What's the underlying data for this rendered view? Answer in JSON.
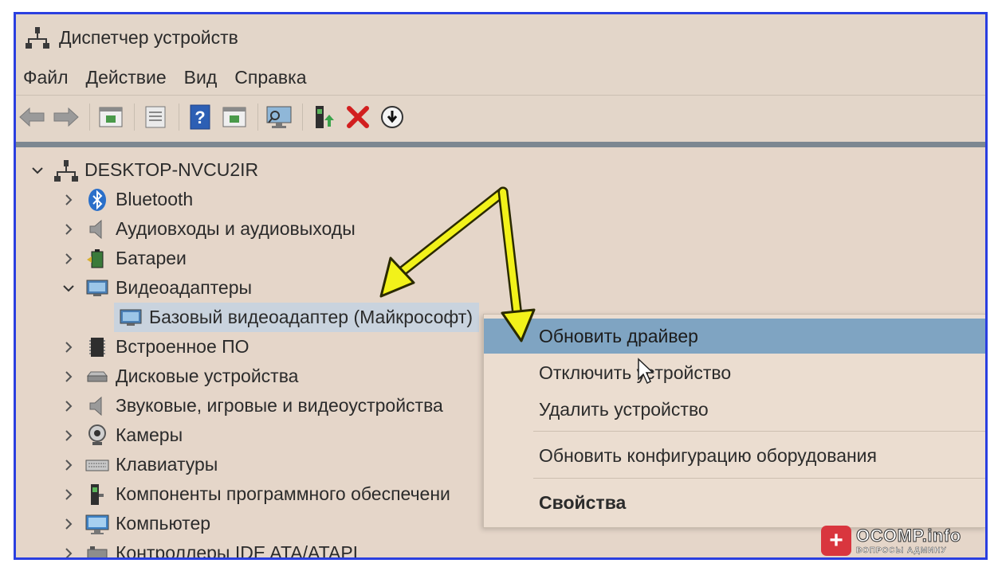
{
  "window": {
    "title": "Диспетчер устройств"
  },
  "menubar": {
    "items": [
      "Файл",
      "Действие",
      "Вид",
      "Справка"
    ]
  },
  "toolbar": {
    "buttons": [
      "back-arrow-icon",
      "forward-arrow-icon",
      "show-hide-console-tree-icon",
      "properties-icon",
      "help-icon",
      "action-pane-icon",
      "scan-hardware-icon",
      "update-driver-icon",
      "uninstall-device-icon",
      "disable-device-icon"
    ]
  },
  "tree": {
    "root": "DESKTOP-NVCU2IR",
    "categories": [
      {
        "label": "Bluetooth",
        "expanded": false,
        "icon": "bluetooth-icon"
      },
      {
        "label": "Аудиовходы и аудиовыходы",
        "expanded": false,
        "icon": "speaker-icon"
      },
      {
        "label": "Батареи",
        "expanded": false,
        "icon": "battery-icon"
      },
      {
        "label": "Видеоадаптеры",
        "expanded": true,
        "icon": "display-adapter-icon"
      },
      {
        "label": "Встроенное ПО",
        "expanded": false,
        "icon": "firmware-icon"
      },
      {
        "label": "Дисковые устройства",
        "expanded": false,
        "icon": "disk-drive-icon"
      },
      {
        "label": "Звуковые, игровые и видеоустройства",
        "expanded": false,
        "icon": "sound-icon"
      },
      {
        "label": "Камеры",
        "expanded": false,
        "icon": "camera-icon"
      },
      {
        "label": "Клавиатуры",
        "expanded": false,
        "icon": "keyboard-icon"
      },
      {
        "label": "Компоненты программного обеспечени",
        "expanded": false,
        "icon": "software-component-icon"
      },
      {
        "label": "Компьютер",
        "expanded": false,
        "icon": "computer-icon"
      },
      {
        "label": "Контроллеры IDE ATA/ATAPI",
        "expanded": false,
        "icon": "ide-controller-icon"
      }
    ],
    "selected_child": "Базовый видеоадаптер (Майкрософт)"
  },
  "context_menu": {
    "items": [
      {
        "label": "Обновить драйвер",
        "highlighted": true
      },
      {
        "label": "Отключить устройство"
      },
      {
        "label": "Удалить устройство"
      },
      {
        "label": "Обновить конфигурацию оборудования"
      },
      {
        "label": "Свойства",
        "bold": true
      }
    ]
  },
  "watermark": {
    "name": "OCOMP.info",
    "subtitle": "ВОПРОСЫ АДМИНУ",
    "badge": "+"
  },
  "colors": {
    "frame_border": "#2a3fe0",
    "background": "#e3d6c9",
    "highlight": "#7fa4c2",
    "selected": "#c9d3de",
    "arrow_fill": "#f2f21a",
    "watermark_red": "#d9363e"
  }
}
